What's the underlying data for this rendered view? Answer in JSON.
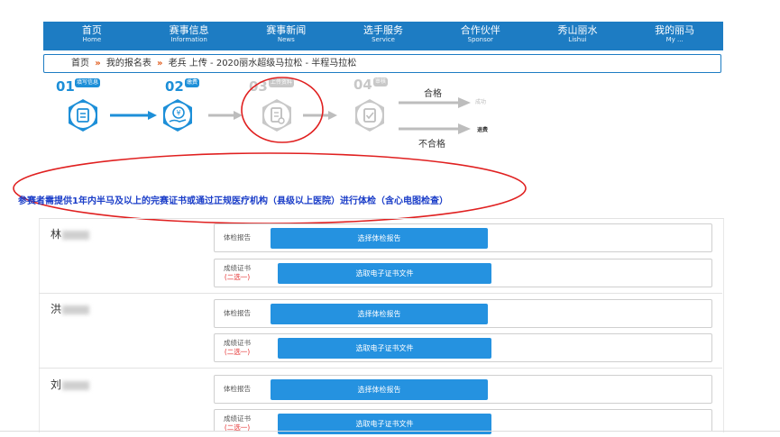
{
  "nav": [
    {
      "cn": "首页",
      "en": "Home"
    },
    {
      "cn": "赛事信息",
      "en": "Information"
    },
    {
      "cn": "赛事新闻",
      "en": "News"
    },
    {
      "cn": "选手服务",
      "en": "Service"
    },
    {
      "cn": "合作伙伴",
      "en": "Sponsor"
    },
    {
      "cn": "秀山丽水",
      "en": "Lishui"
    },
    {
      "cn": "我的丽马",
      "en": "My ..."
    }
  ],
  "breadcrumb": {
    "home": "首页",
    "sep": "»",
    "item1": "我的报名表",
    "item2": "老兵 上传 - 2020丽水超级马拉松 - 半程马拉松"
  },
  "steps": [
    {
      "num": "01",
      "tag": "填写信息",
      "color": "#1d8fd8"
    },
    {
      "num": "02",
      "tag": "缴费",
      "color": "#1d8fd8"
    },
    {
      "num": "03",
      "tag": "上传资料",
      "color": "#c8c8c8"
    },
    {
      "num": "04",
      "tag": "审核",
      "color": "#c8c8c8"
    }
  ],
  "results": {
    "pass": "合格",
    "pass_small": "成功",
    "fail": "不合格",
    "fail_small": "退费"
  },
  "notice": "参赛者需提供1年内半马及以上的完赛证书或通过正规医疗机构（县级以上医院）进行体检（含心电图检查）",
  "participants": [
    {
      "name": "林",
      "health_label": "体检报告",
      "health_button": "选择体检报告",
      "cert_label": "成绩证书",
      "cert_sub": "(二选一)",
      "cert_button": "选取电子证书文件"
    },
    {
      "name": "洪",
      "health_label": "体检报告",
      "health_button": "选择体检报告",
      "cert_label": "成绩证书",
      "cert_sub": "(二选一)",
      "cert_button": "选取电子证书文件"
    },
    {
      "name": "刘",
      "health_label": "体检报告",
      "health_button": "选择体检报告",
      "cert_label": "成绩证书",
      "cert_sub": "(二选一)",
      "cert_button": "选取电子证书文件"
    }
  ],
  "colors": {
    "nav_bg": "#1d7cc3",
    "button": "#2592e0",
    "active_step": "#1d8fd8",
    "inactive_step": "#c8c8c8",
    "annotation": "#e02020",
    "notice": "#1a3dc8"
  }
}
